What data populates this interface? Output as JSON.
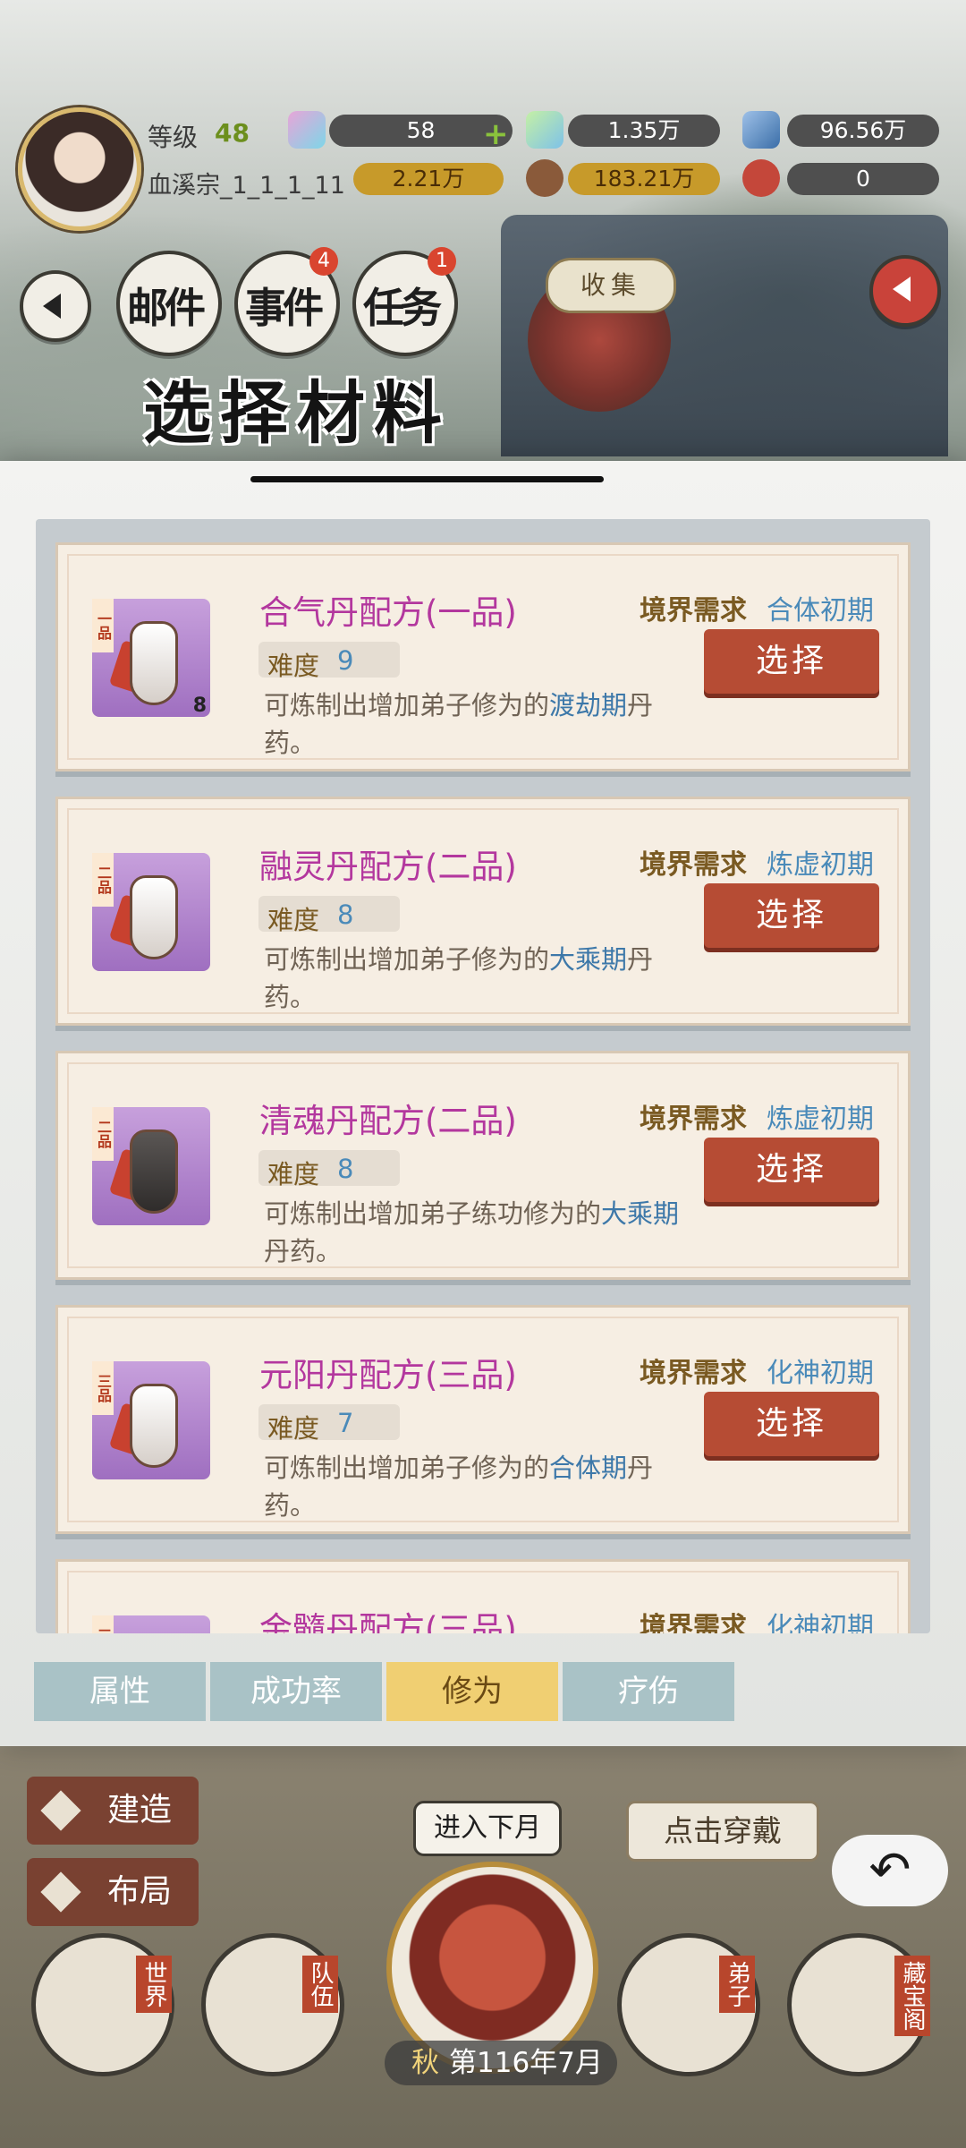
{
  "hud": {
    "level_label": "等级",
    "level_value": "48",
    "sect_name": "血溪宗_1_1_1_11",
    "resources": [
      {
        "value": "58"
      },
      {
        "value": "1.35万"
      },
      {
        "value": "96.56万"
      },
      {
        "value": "2.21万"
      },
      {
        "value": "183.21万"
      },
      {
        "value": "0"
      }
    ],
    "plus_symbol": "+"
  },
  "nav": {
    "mail": {
      "label": "邮件"
    },
    "events": {
      "label": "事件",
      "badge": "4"
    },
    "tasks": {
      "label": "任务",
      "badge": "1"
    },
    "collect": "收集"
  },
  "panel": {
    "title": "选择材料",
    "require_label": "境界需求",
    "difficulty_label": "难度",
    "select_label": "选择",
    "recipes": [
      {
        "grade": "一品",
        "name": "合气丹配方(一品)",
        "requirement": "合体初期",
        "difficulty": "9",
        "desc_pre": "可炼制出增加弟子修为的",
        "desc_hl": "渡劫期",
        "desc_post": "丹药。",
        "count": "8"
      },
      {
        "grade": "二品",
        "name": "融灵丹配方(二品)",
        "requirement": "炼虚初期",
        "difficulty": "8",
        "desc_pre": "可炼制出增加弟子修为的",
        "desc_hl": "大乘期",
        "desc_post": "丹药。"
      },
      {
        "grade": "二品",
        "name": "清魂丹配方(二品)",
        "requirement": "炼虚初期",
        "difficulty": "8",
        "desc_pre": "可炼制出增加弟子练功修为的",
        "desc_hl": "大乘期",
        "desc_post": "丹药。"
      },
      {
        "grade": "三品",
        "name": "元阳丹配方(三品)",
        "requirement": "化神初期",
        "difficulty": "7",
        "desc_pre": "可炼制出增加弟子修为的",
        "desc_hl": "合体期",
        "desc_post": "丹药。"
      },
      {
        "grade": "三品",
        "name": "金髓丹配方(三品)",
        "requirement": "化神初期"
      }
    ]
  },
  "tabs": [
    {
      "label": "属性",
      "active": false
    },
    {
      "label": "成功率",
      "active": false
    },
    {
      "label": "修为",
      "active": true
    },
    {
      "label": "疗伤",
      "active": false
    }
  ],
  "bottom": {
    "build": "建造",
    "layout": "布局",
    "next_month": "进入下月",
    "wear": "点击穿戴",
    "season": "秋",
    "date": "第116年7月",
    "nav": [
      {
        "label": "世界"
      },
      {
        "label": "队伍"
      },
      {
        "label": "弟子"
      },
      {
        "label": "藏宝阁"
      }
    ],
    "back_symbol": "↶"
  },
  "colors": {
    "accent_button": "#b64c34",
    "recipe_name": "#b3379e",
    "highlight_blue": "#4a8ab9",
    "active_tab": "#f0cf72",
    "inactive_tab": "#a9c2c6"
  }
}
